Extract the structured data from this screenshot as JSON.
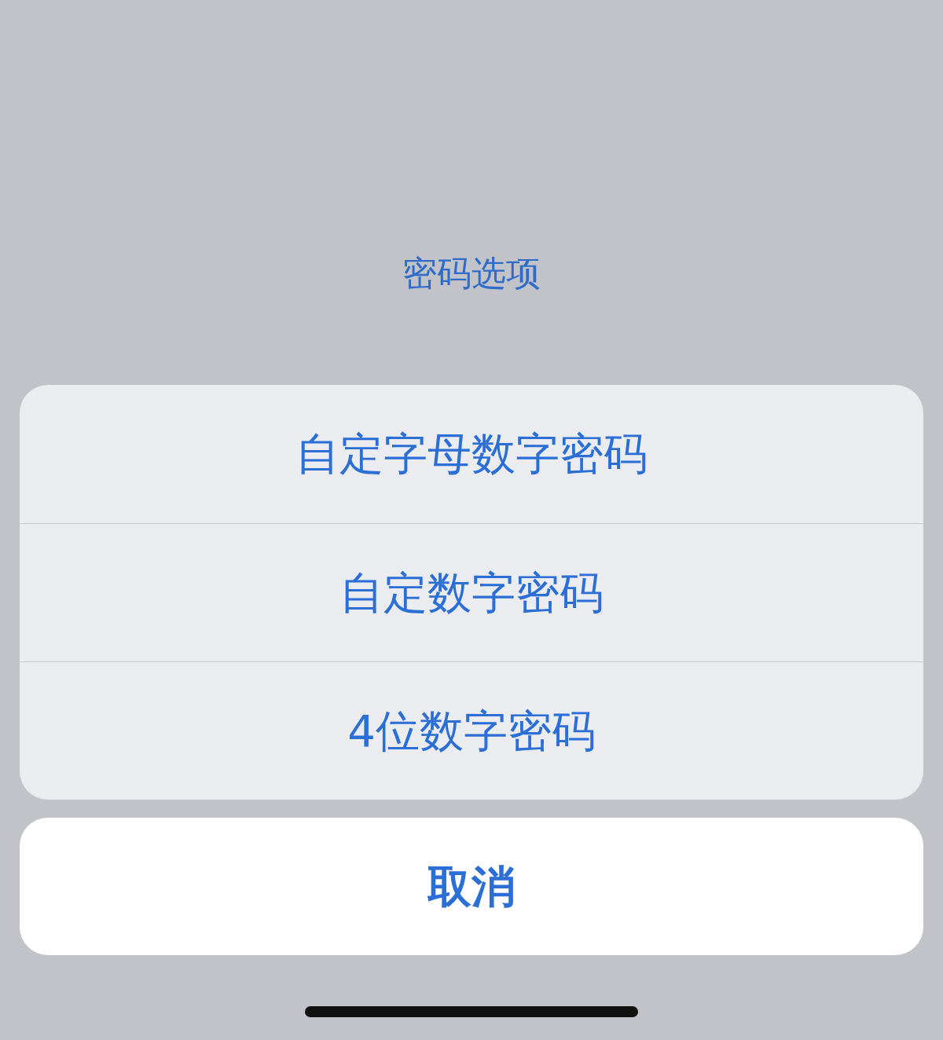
{
  "title": "密码选项",
  "options": [
    {
      "label": "自定字母数字密码"
    },
    {
      "label": "自定数字密码"
    },
    {
      "label": "4位数字密码"
    }
  ],
  "cancel_button": "取消"
}
